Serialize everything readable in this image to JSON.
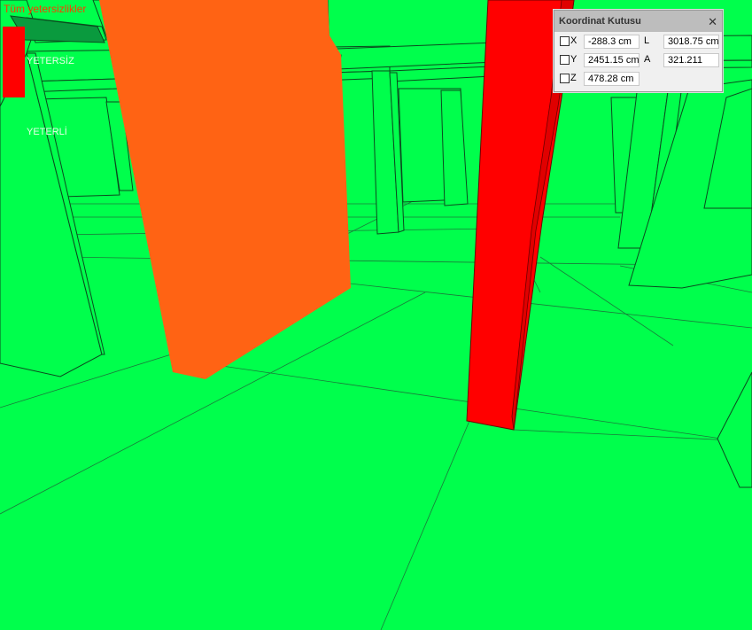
{
  "legend": {
    "title": "Tüm yetersizlikler",
    "swatch_color": "#ff0000",
    "label_fail": "YETERSİZ",
    "label_ok": "YETERLİ"
  },
  "scene": {
    "ground_color": "#00ff4c",
    "edge_color": "#0b4a1e",
    "highlight_orange": "#ff6314",
    "highlight_red": "#ff0000"
  },
  "coordinate_box": {
    "title": "Koordinat Kutusu",
    "close_icon": "close-icon",
    "x_label": "X",
    "x_value": "-288.3 cm",
    "y_label": "Y",
    "y_value": "2451.15 cm",
    "z_label": "Z",
    "z_value": "478.28 cm",
    "l_label": "L",
    "l_value": "3018.75 cm",
    "a_label": "A",
    "a_value": "321.211"
  }
}
